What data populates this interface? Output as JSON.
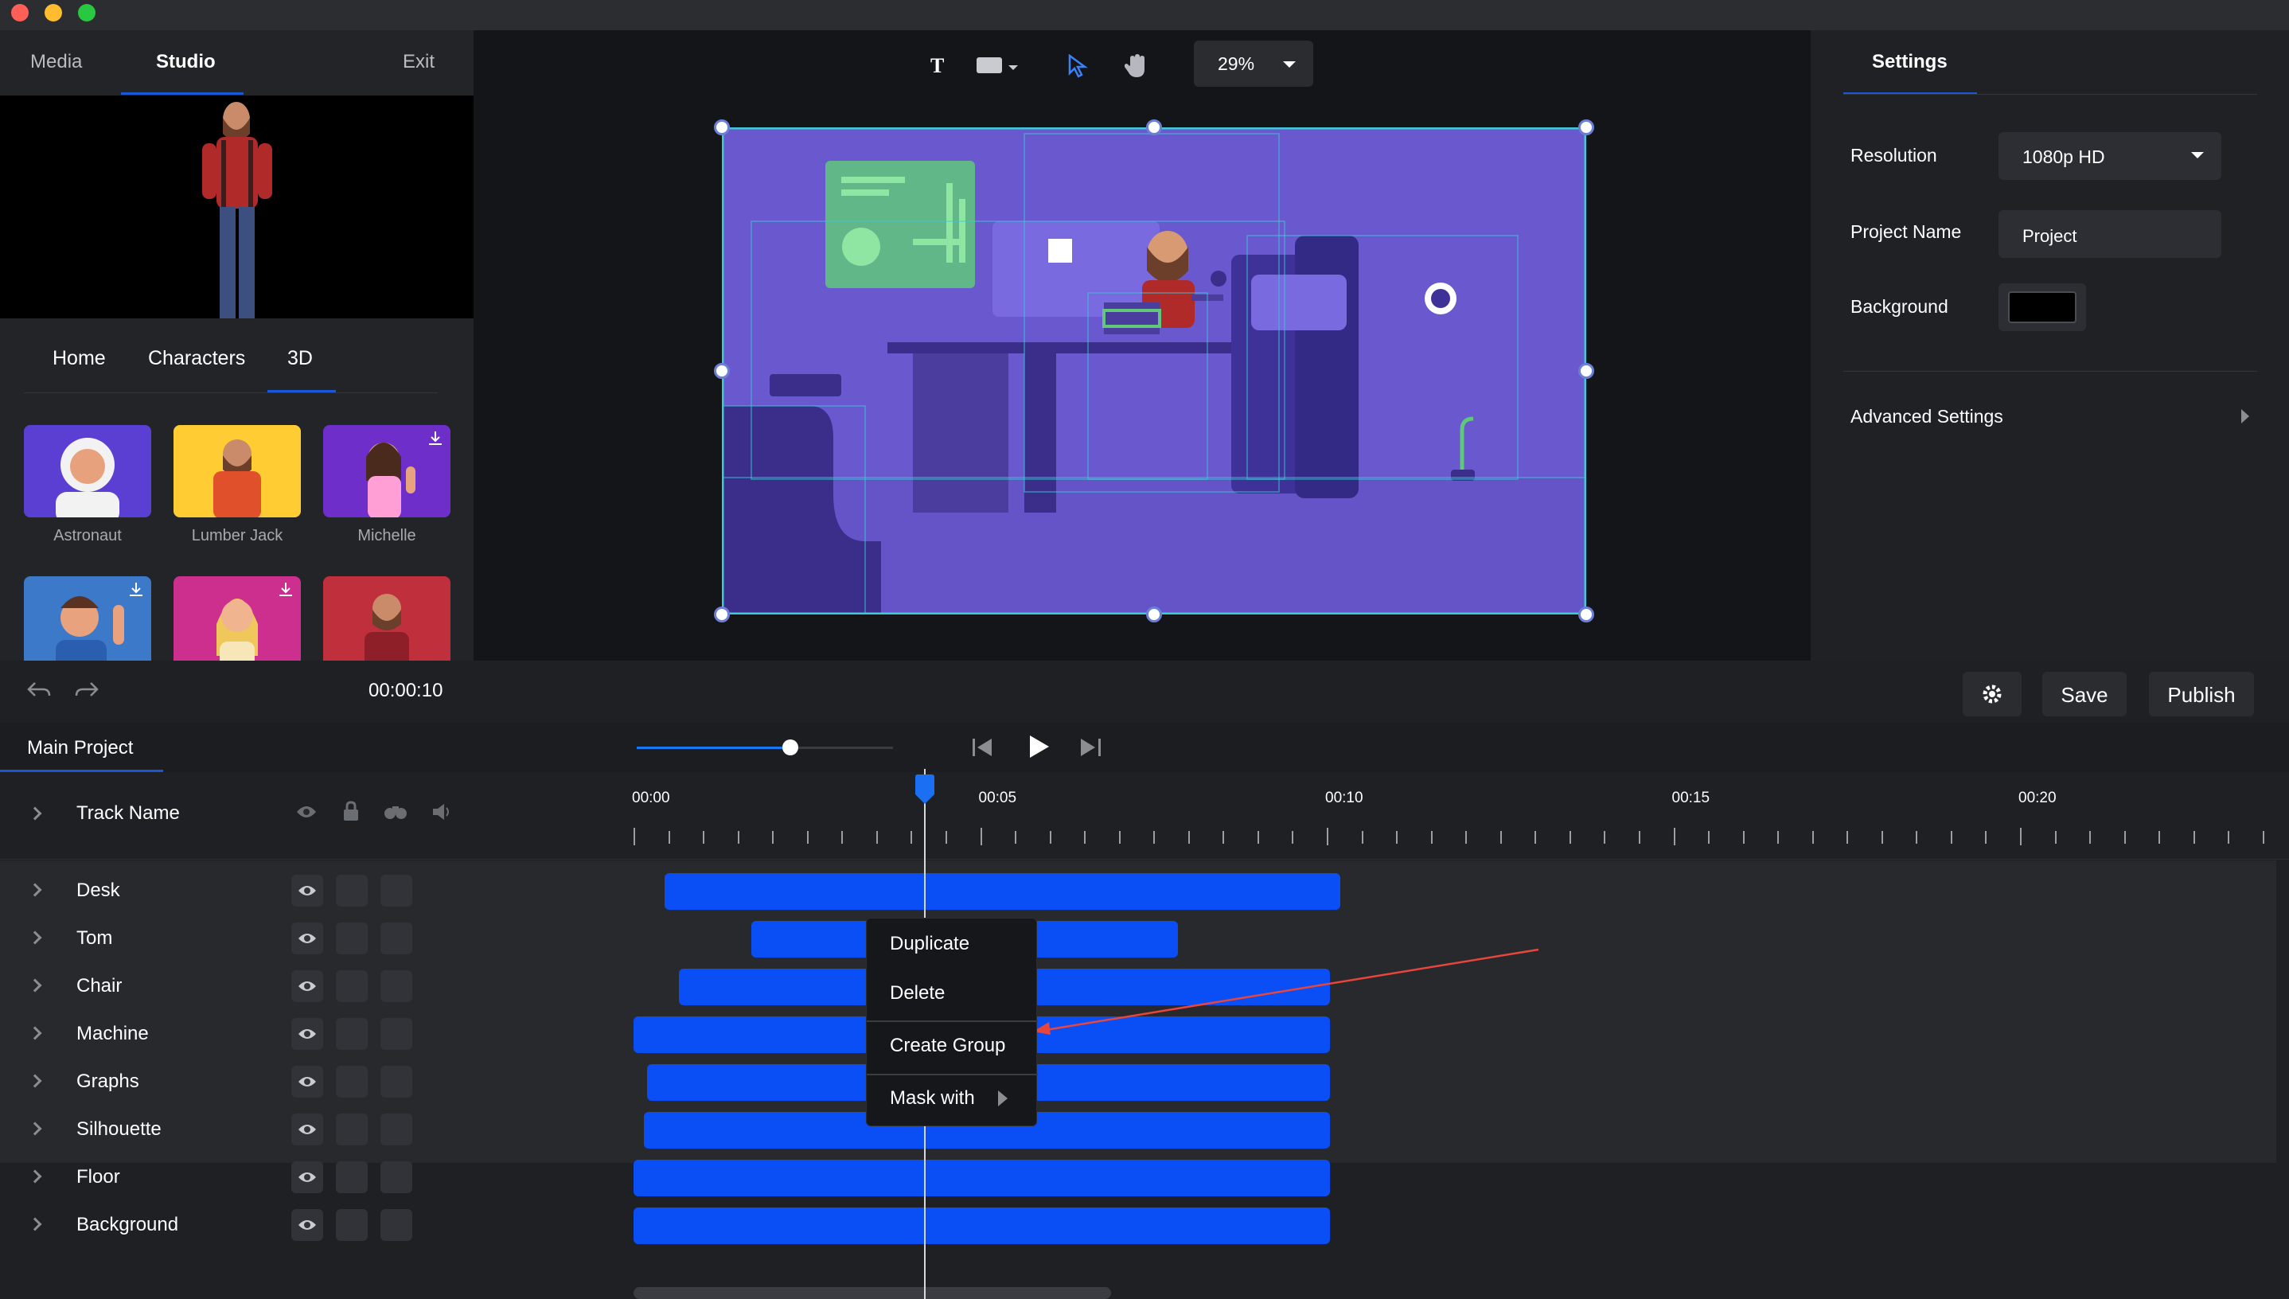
{
  "window": {
    "traffic_lights": [
      "#ff5f57",
      "#febc2e",
      "#28c840"
    ]
  },
  "left_panel": {
    "tabs": [
      "Media",
      "Studio"
    ],
    "exit_label": "Exit",
    "sub_tabs": [
      "Home",
      "Characters",
      "3D"
    ],
    "characters": [
      {
        "name": "Astronaut",
        "bg": "#5b3fd2"
      },
      {
        "name": "Lumber Jack",
        "bg": "#ffcc33"
      },
      {
        "name": "Michelle",
        "bg": "#6e2ec9",
        "download": true
      },
      {
        "name": "",
        "bg": "#3d79c9",
        "download": true
      },
      {
        "name": "",
        "bg": "#cc2f8e",
        "download": true
      },
      {
        "name": "",
        "bg": "#c0303c"
      }
    ]
  },
  "toolbar": {
    "text_tool": "T",
    "zoom": "29%",
    "icons": [
      "text-icon",
      "shape-icon",
      "pointer-icon",
      "hand-icon",
      "chevron-down-icon"
    ]
  },
  "settings": {
    "title": "Settings",
    "resolution_label": "Resolution",
    "resolution_value": "1080p HD",
    "project_name_label": "Project Name",
    "project_name_value": "Project",
    "background_label": "Background",
    "background_color": "#000000",
    "advanced_label": "Advanced Settings"
  },
  "controls": {
    "timecode": "00:00:10",
    "save_label": "Save",
    "publish_label": "Publish",
    "playback_progress": 0.6
  },
  "timeline": {
    "project_tab": "Main Project",
    "track_name_header": "Track Name",
    "ruler_labels": [
      "00:00",
      "00:05",
      "00:10",
      "00:15",
      "00:20"
    ],
    "playhead_seconds": 4.2,
    "tracks": [
      {
        "name": "Desk",
        "start": 0.45,
        "end": 10.2
      },
      {
        "name": "Tom",
        "start": 1.7,
        "end": 7.85
      },
      {
        "name": "Chair",
        "start": 0.65,
        "end": 10.05
      },
      {
        "name": "Machine",
        "start": 0.0,
        "end": 10.05
      },
      {
        "name": "Graphs",
        "start": 0.2,
        "end": 10.05
      },
      {
        "name": "Silhouette",
        "start": 0.15,
        "end": 10.05
      },
      {
        "name": "Floor",
        "start": 0.0,
        "end": 10.05
      },
      {
        "name": "Background",
        "start": 0.0,
        "end": 10.05
      }
    ]
  },
  "context_menu": {
    "items": [
      "Duplicate",
      "Delete",
      "Create Group",
      "Mask with"
    ]
  },
  "accent": "#1a57d6",
  "track_bar_color": "#0a4ff5",
  "annotation_arrow_color": "#e8453c"
}
